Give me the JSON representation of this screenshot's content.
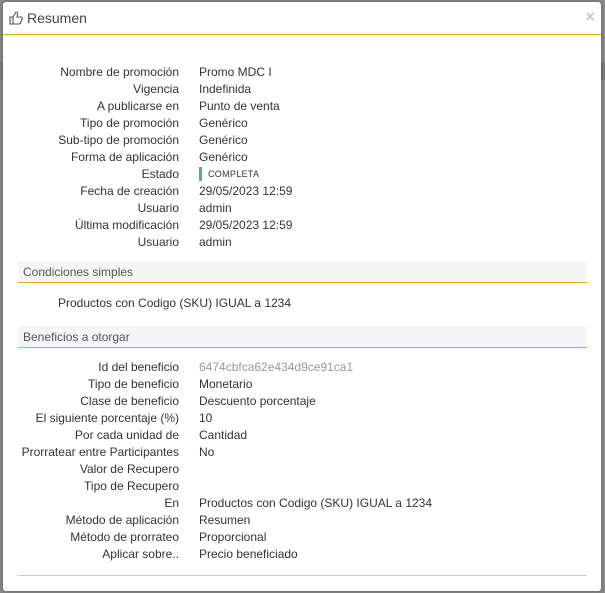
{
  "modal": {
    "title": "Resumen",
    "close_glyph": "×"
  },
  "summary": [
    {
      "label": "Nombre de promoción",
      "value": "Promo MDC I"
    },
    {
      "label": "Vigencia",
      "value": "Indefinida"
    },
    {
      "label": "A publicarse en",
      "value": "Punto de venta"
    },
    {
      "label": "Tipo de promoción",
      "value": "Genérico"
    },
    {
      "label": "Sub-tipo de promoción",
      "value": "Genérico"
    },
    {
      "label": "Forma de aplicación",
      "value": "Genérico"
    },
    {
      "label": "Estado",
      "value": "COMPLETA"
    },
    {
      "label": "Fecha de creación",
      "value": "29/05/2023 12:59"
    },
    {
      "label": "Usuario",
      "value": "admin"
    },
    {
      "label": "Última modificación",
      "value": "29/05/2023 12:59"
    },
    {
      "label": "Usuario",
      "value": "admin"
    }
  ],
  "status_color": "#5cb85c",
  "accent_color": "#e0b400",
  "conditions": {
    "title": "Condiciones simples",
    "items": [
      "Productos con Codigo (SKU) IGUAL a 1234"
    ]
  },
  "benefits": {
    "title": "Beneficios a otorgar",
    "rows": [
      {
        "label": "Id del beneficio",
        "value": "6474cbfca62e434d9ce91ca1"
      },
      {
        "label": "Tipo de beneficio",
        "value": "Monetario"
      },
      {
        "label": "Clase de beneficio",
        "value": "Descuento porcentaje"
      },
      {
        "label": "El siguiente porcentaje (%)",
        "value": "10"
      },
      {
        "label": "Por cada unidad de",
        "value": "Cantidad"
      },
      {
        "label": "Prorratear entre Participantes",
        "value": "No"
      },
      {
        "label": "Valor de Recupero",
        "value": ""
      },
      {
        "label": "Tipo de Recupero",
        "value": ""
      },
      {
        "label": "En",
        "value": "Productos con Codigo (SKU) IGUAL a 1234"
      },
      {
        "label": "Método de aplicación",
        "value": "Resumen"
      },
      {
        "label": "Método de prorrateo",
        "value": "Proporcional"
      },
      {
        "label": "Aplicar sobre..",
        "value": "Precio beneficiado"
      }
    ]
  },
  "icons": {
    "header": "thumbs-up-icon",
    "close": "close-icon"
  }
}
